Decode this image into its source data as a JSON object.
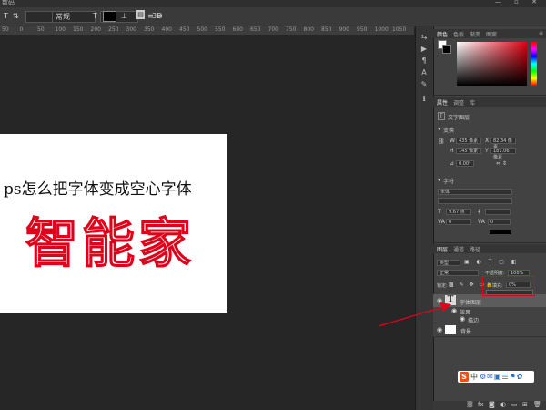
{
  "app": {
    "title_fragment": "数码"
  },
  "options_bar": {
    "font_style": "常规",
    "align_left": "≡",
    "align_center": "≡",
    "align_right": "≡",
    "mode_3d": "3D"
  },
  "ruler_ticks": [
    "50",
    "0",
    "50",
    "100",
    "150",
    "200",
    "250",
    "300",
    "350",
    "400",
    "450",
    "500",
    "550",
    "600",
    "650",
    "700",
    "750",
    "800",
    "850",
    "900",
    "950",
    "1000",
    "1050"
  ],
  "canvas": {
    "line1": "ps怎么把字体变成空心字体",
    "big_text": "智能家"
  },
  "color_panel": {
    "tabs": [
      "颜色",
      "色板",
      "渐变",
      "图案"
    ],
    "fg_color": "#ffffff",
    "bg_color": "#000000",
    "picker_hue": "#e00010"
  },
  "properties_panel": {
    "tabs": [
      "属性",
      "调整",
      "库"
    ],
    "layer_type": "文字图层",
    "transform_title": "变换",
    "w_label": "W",
    "w_value": "435 像素",
    "h_label": "H",
    "h_value": "145 像素",
    "x_label": "X",
    "x_value": "82.34 像素",
    "y_label": "Y",
    "y_value": "181.06 像素",
    "angle_value": "0.00°",
    "char_title": "字符",
    "font_family": "宋体",
    "font_size": "9.67 点",
    "va_label": "VA",
    "va_value": "0",
    "tracking": "0"
  },
  "layers_panel": {
    "tabs": [
      "图层",
      "通道",
      "路径"
    ],
    "filter_kind": "类型",
    "blend_mode": "正常",
    "opacity_label": "不透明度:",
    "opacity_value": "100%",
    "lock_label": "锁定:",
    "fill_label": "填充:",
    "fill_value": "0%",
    "layers": [
      {
        "name": "字体图层",
        "type": "text"
      },
      {
        "name": "效果",
        "type": "effects"
      },
      {
        "name": "描边",
        "type": "effect"
      },
      {
        "name": "背景",
        "type": "background"
      }
    ]
  },
  "ime_bar": {
    "logo": "S",
    "label": "中"
  },
  "bottom_bar": {
    "fx": "fx"
  },
  "colors": {
    "accent_red": "#e2001a",
    "panel_bg": "#424242"
  }
}
